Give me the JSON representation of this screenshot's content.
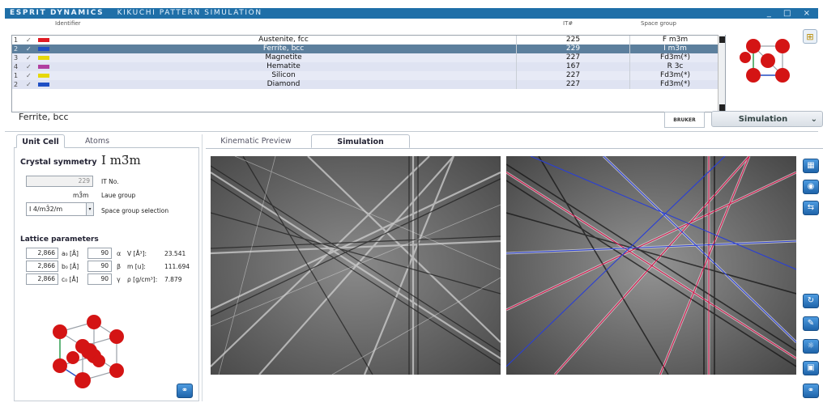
{
  "window": {
    "title_brand": "ESPRIT DYNAMICS",
    "title_text": "KIKUCHI PATTERN SIMULATION",
    "controls": "_ □ ×"
  },
  "table": {
    "headers": {
      "identifier": "Identifier",
      "it": "IT#",
      "space_group": "Space group"
    },
    "rows": [
      {
        "num": "1",
        "check": "✓",
        "color": "#e01b24",
        "identifier": "Austenite, fcc",
        "it": "225",
        "space_group": "F m3m"
      },
      {
        "num": "2",
        "check": "✓",
        "color": "#1f4fc4",
        "identifier": "Ferrite, bcc",
        "it": "229",
        "space_group": "I m3m"
      },
      {
        "num": "3",
        "check": "✓",
        "color": "#e6d80a",
        "identifier": "Magnetite",
        "it": "227",
        "space_group": "Fd3m(*)"
      },
      {
        "num": "4",
        "check": "✓",
        "color": "#b03fa0",
        "identifier": "Hematite",
        "it": "167",
        "space_group": "R 3c"
      },
      {
        "num": "1",
        "check": "✓",
        "color": "#e6d80a",
        "identifier": "Silicon",
        "it": "227",
        "space_group": "Fd3m(*)"
      },
      {
        "num": "2",
        "check": "✓",
        "color": "#1f4fc4",
        "identifier": "Diamond",
        "it": "227",
        "space_group": "Fd3m(*)"
      }
    ],
    "selected_index": 1
  },
  "phase": {
    "name": "Ferrite, bcc"
  },
  "bruker_logo": "BRUKER",
  "sim_dropdown": {
    "label": "Simulation"
  },
  "left_tabs": [
    "Unit Cell",
    "Atoms"
  ],
  "right_tabs": [
    "Kinematic Preview",
    "Simulation"
  ],
  "unit_cell": {
    "crystal_symmetry_label": "Crystal symmetry",
    "symbol": "I m3̄m",
    "it_no_value": "229",
    "it_no_label": "IT No.",
    "laue_value": "m3̄m",
    "laue_label": "Laue group",
    "sg_selection_value": "I 4/m3̄2/m",
    "sg_selection_label": "Space group selection",
    "lattice_label": "Lattice parameters",
    "params": [
      {
        "value": "2,866",
        "name": "a₀ [Å]",
        "angle": "90",
        "greek": "α"
      },
      {
        "value": "2,866",
        "name": "b₀ [Å]",
        "angle": "90",
        "greek": "β"
      },
      {
        "value": "2,866",
        "name": "c₀ [Å]",
        "angle": "90",
        "greek": "γ"
      }
    ],
    "derived": [
      {
        "name": "V [Å³]:",
        "value": "23.541"
      },
      {
        "name": "m [u]:",
        "value": "111.694"
      },
      {
        "name": "ρ [g/cm³]:",
        "value": "7.879"
      }
    ]
  },
  "colors": {
    "accent": "#1f6fa8",
    "selection": "#5c7f9d",
    "atom": "#d41414"
  }
}
